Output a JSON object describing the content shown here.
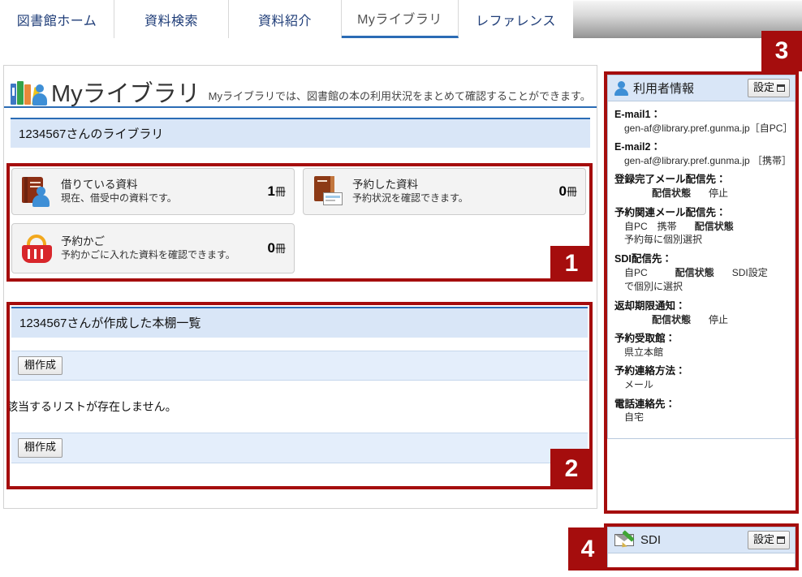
{
  "nav": {
    "tabs": [
      {
        "label": "図書館ホーム",
        "active": false
      },
      {
        "label": "資料検索",
        "active": false
      },
      {
        "label": "資料紹介",
        "active": false
      },
      {
        "label": "Myライブラリ",
        "active": true
      },
      {
        "label": "レファレンス",
        "active": false
      }
    ]
  },
  "page": {
    "title": "Myライブラリ",
    "subtitle": "Myライブラリでは、図書館の本の利用状況をまとめて確認することができます。",
    "icon": "books-and-user-icon"
  },
  "library_section": {
    "heading": "1234567さんのライブラリ",
    "cards": [
      {
        "icon": "book-with-person-icon",
        "title": "借りている資料",
        "description": "現在、借受中の資料です。",
        "count": "1",
        "unit": "冊"
      },
      {
        "icon": "book-with-card-icon",
        "title": "予約した資料",
        "description": "予約状況を確認できます。",
        "count": "0",
        "unit": "冊"
      },
      {
        "icon": "basket-icon",
        "title": "予約かご",
        "description": "予約かごに入れた資料を確認できます。",
        "count": "0",
        "unit": "冊"
      }
    ]
  },
  "shelf_section": {
    "heading": "1234567さんが作成した本棚一覧",
    "create_button_top": "棚作成",
    "empty_message": "該当するリストが存在しません。",
    "create_button_bottom": "棚作成"
  },
  "sidebar": {
    "user_info": {
      "icon": "user-icon",
      "title": "利用者情報",
      "settings_button": "設定",
      "fields": [
        {
          "label": "E-mail1：",
          "value": "gen-af@library.pref.gunma.jp［自PC］"
        },
        {
          "label": "E-mail2：",
          "value": "gen-af@library.pref.gunma.jp ［携帯］"
        }
      ],
      "registration_mail": {
        "label": "登録完了メール配信先：",
        "status_label": "配信状態",
        "status_value": "停止"
      },
      "reservation_mail": {
        "label": "予約関連メール配信先：",
        "targets": "自PC　携帯",
        "status_label": "配信状態",
        "note": "予約毎に個別選択"
      },
      "sdi_delivery": {
        "label": "SDI配信先：",
        "targets": "自PC",
        "status_label": "配信状態",
        "setting_label": "SDI設定",
        "note": "で個別に選択"
      },
      "due_notice": {
        "label": "返却期限通知：",
        "status_label": "配信状態",
        "status_value": "停止"
      },
      "pickup_library": {
        "label": "予約受取館：",
        "value": "県立本館"
      },
      "contact_method": {
        "label": "予約連絡方法：",
        "value": "メール"
      },
      "phone_contact": {
        "label": "電話連絡先：",
        "value": "自宅"
      }
    },
    "sdi_panel": {
      "icon": "mail-pencil-icon",
      "title": "SDI",
      "settings_button": "設定"
    }
  },
  "annotations": {
    "badge1": "1",
    "badge2": "2",
    "badge3": "3",
    "badge4": "4",
    "color": "#a50d0d"
  }
}
